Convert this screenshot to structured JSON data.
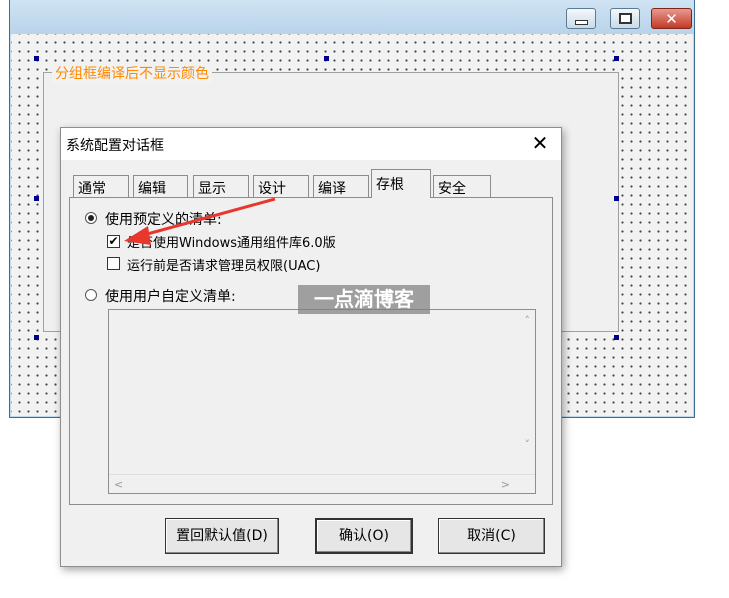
{
  "designer": {
    "groupbox_caption": "分组框编译后不显示颜色",
    "close_glyph": "✕"
  },
  "dialog": {
    "title": "系统配置对话框",
    "close_glyph": "✕",
    "tabs": [
      "通常",
      "编辑",
      "显示",
      "设计",
      "编译",
      "存根",
      "安全"
    ],
    "active_tab": "存根",
    "options": {
      "predefined_label": "使用预定义的清单:",
      "predefined_checked": true,
      "use_common_controls_label": "是否使用Windows通用组件库6.0版",
      "use_common_controls_checked": true,
      "request_admin_label": "运行前是否请求管理员权限(UAC)",
      "request_admin_checked": false,
      "custom_label": "使用用户自定义清单:",
      "custom_checked": false
    },
    "scroll": {
      "up": "˄",
      "down": "˅",
      "left": "<",
      "right": ">"
    },
    "buttons": {
      "restore_defaults": "置回默认值(D)",
      "ok": "确认(O)",
      "cancel": "取消(C)"
    }
  },
  "watermark": "一点滴博客",
  "colors": {
    "groupbox_caption": "#ff8a00",
    "annotation_arrow": "#e8382e",
    "handle": "#00008b"
  }
}
